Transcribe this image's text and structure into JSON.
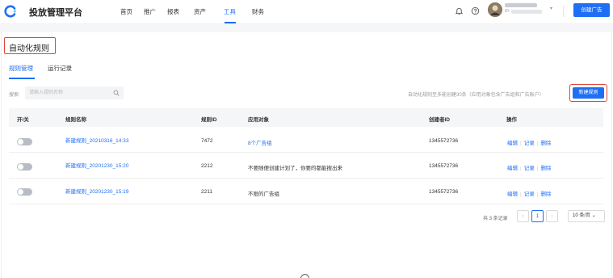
{
  "header": {
    "brand": "投放管理平台",
    "nav": [
      {
        "label": "首页"
      },
      {
        "label": "推广"
      },
      {
        "label": "报表"
      },
      {
        "label": "资产"
      },
      {
        "label": "工具"
      },
      {
        "label": "财务"
      }
    ],
    "active_nav": "工具",
    "account_id_prefix": "ID:",
    "create_ad_label": "创建广告",
    "brand_color": "#1f6ff5",
    "icons": [
      "bell-icon",
      "help-icon",
      "chevron-down-icon"
    ]
  },
  "page": {
    "title": "自动化规则",
    "tabs": [
      {
        "label": "规则管理"
      },
      {
        "label": "运行记录"
      }
    ],
    "active_tab": "规则管理"
  },
  "toolbar": {
    "search_label": "搜索:",
    "search_placeholder": "请输入规则名称",
    "search_value": "",
    "hint": "自动化规则至多能创建30条（应用对象包含广告组和广告账户）",
    "new_rule_label": "新建规则"
  },
  "table": {
    "columns": [
      "开/关",
      "规则名称",
      "规则ID",
      "应用对象",
      "创建者ID",
      "操作"
    ],
    "rows": [
      {
        "enabled": false,
        "name": "新建规则_20210316_14:33",
        "id": "7472",
        "target": "8个广告组",
        "target_is_link": true,
        "creator": "1345572736"
      },
      {
        "enabled": false,
        "name": "新建规则_20201230_15:20",
        "id": "2212",
        "target": "不要随便创建计划了，你要的都能搜出来",
        "target_is_link": false,
        "creator": "1345572736"
      },
      {
        "enabled": false,
        "name": "新建规则_20201230_15:19",
        "id": "2211",
        "target": "不限的广告组",
        "target_is_link": false,
        "creator": "1345572736"
      }
    ],
    "actions": [
      "编辑",
      "记录",
      "删除"
    ]
  },
  "pagination": {
    "total_text": "共 3 条记录",
    "current_page": "1",
    "prev": "‹",
    "next": "›",
    "page_size": "10 条/页"
  },
  "colors": {
    "accent": "#1f6ff5",
    "highlight_border": "#e0453a",
    "toggle_off": "#b8bcc4"
  }
}
